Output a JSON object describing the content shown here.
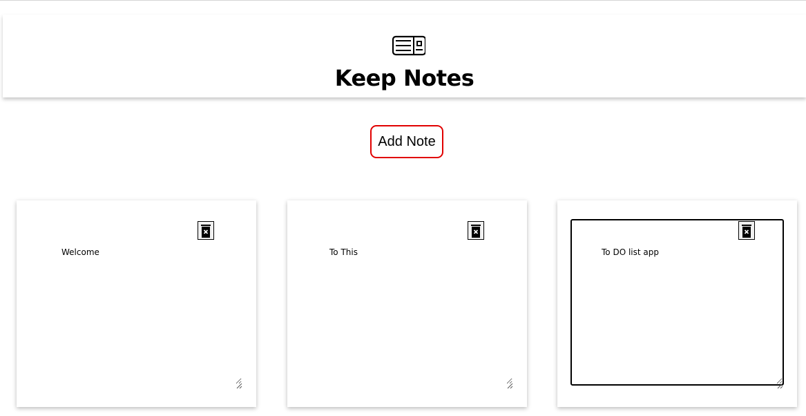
{
  "header": {
    "icon": "notes-icon",
    "title": "Keep Notes"
  },
  "actions": {
    "add_note_label": "Add Note",
    "accent_color": "#e10000"
  },
  "notes": [
    {
      "text": "Welcome",
      "focused": false
    },
    {
      "text": "To This",
      "focused": false
    },
    {
      "text": "To DO list app",
      "focused": true
    }
  ]
}
